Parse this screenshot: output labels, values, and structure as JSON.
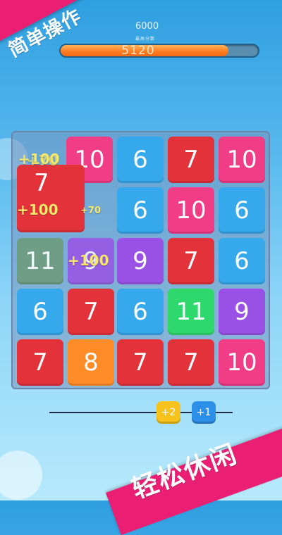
{
  "header": {
    "target_score": "6000",
    "target_label": "最高分数",
    "current_score": "5120",
    "progress": 0.85
  },
  "ribbons": {
    "top_text": "简单操作",
    "bottom_text": "轻松休闲"
  },
  "colors": {
    "pink": "#f13c86",
    "red": "#e4323b",
    "blue": "#36a8ec",
    "purple": "#9a52e6",
    "green": "#2fd86c",
    "gray_green": "#6e9c7d",
    "orange": "#ff8c26"
  },
  "board": {
    "tiles": [
      {
        "label": "10",
        "color": "pink"
      },
      {
        "label": "6",
        "color": "blue"
      },
      {
        "label": "7",
        "color": "red"
      },
      {
        "label": "10",
        "color": "pink"
      },
      {
        "label": "7",
        "color": "red"
      },
      {
        "label": "6",
        "color": "blue"
      },
      {
        "label": "10",
        "color": "pink"
      },
      {
        "label": "6",
        "color": "blue"
      },
      {
        "label": "11",
        "color": "gray_green"
      },
      {
        "label": "9",
        "color": "purple"
      },
      {
        "label": "9",
        "color": "purple"
      },
      {
        "label": "7",
        "color": "red"
      },
      {
        "label": "6",
        "color": "blue"
      },
      {
        "label": "6",
        "color": "blue"
      },
      {
        "label": "7",
        "color": "red"
      },
      {
        "label": "6",
        "color": "blue"
      },
      {
        "label": "11",
        "color": "green"
      },
      {
        "label": "9",
        "color": "purple"
      },
      {
        "label": "7",
        "color": "red"
      },
      {
        "label": "8",
        "color": "orange"
      },
      {
        "label": "7",
        "color": "red"
      },
      {
        "label": "7",
        "color": "red"
      },
      {
        "label": "10",
        "color": "pink"
      }
    ],
    "floating_scores": [
      "+100",
      "+70",
      "+100",
      "+70",
      "+100"
    ]
  },
  "boosters": [
    {
      "label": "+2",
      "color": "#f7c21c"
    },
    {
      "label": "+1",
      "color": "#2c8fe8"
    }
  ]
}
